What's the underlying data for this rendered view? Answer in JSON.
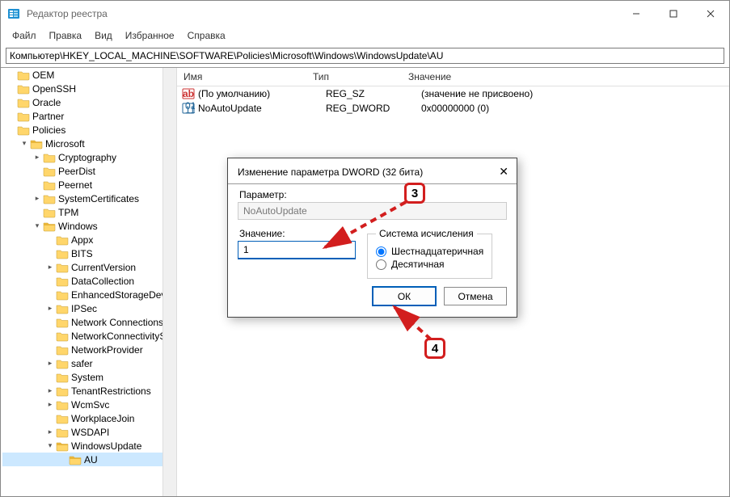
{
  "window": {
    "title": "Редактор реестра"
  },
  "menu": {
    "file": "Файл",
    "edit": "Правка",
    "view": "Вид",
    "favorites": "Избранное",
    "help": "Справка"
  },
  "address": "Компьютер\\HKEY_LOCAL_MACHINE\\SOFTWARE\\Policies\\Microsoft\\Windows\\WindowsUpdate\\AU",
  "tree": [
    {
      "label": "OEM",
      "depth": 1,
      "twisty": "",
      "open": false
    },
    {
      "label": "OpenSSH",
      "depth": 1,
      "twisty": "",
      "open": false
    },
    {
      "label": "Oracle",
      "depth": 1,
      "twisty": "",
      "open": false
    },
    {
      "label": "Partner",
      "depth": 1,
      "twisty": "",
      "open": false
    },
    {
      "label": "Policies",
      "depth": 1,
      "twisty": "",
      "open": false
    },
    {
      "label": "Microsoft",
      "depth": 2,
      "twisty": "v",
      "open": true
    },
    {
      "label": "Cryptography",
      "depth": 3,
      "twisty": ">",
      "open": false
    },
    {
      "label": "PeerDist",
      "depth": 3,
      "twisty": "",
      "open": false
    },
    {
      "label": "Peernet",
      "depth": 3,
      "twisty": "",
      "open": false
    },
    {
      "label": "SystemCertificates",
      "depth": 3,
      "twisty": ">",
      "open": false
    },
    {
      "label": "TPM",
      "depth": 3,
      "twisty": "",
      "open": false
    },
    {
      "label": "Windows",
      "depth": 3,
      "twisty": "v",
      "open": true
    },
    {
      "label": "Appx",
      "depth": 4,
      "twisty": "",
      "open": false
    },
    {
      "label": "BITS",
      "depth": 4,
      "twisty": "",
      "open": false
    },
    {
      "label": "CurrentVersion",
      "depth": 4,
      "twisty": ">",
      "open": false
    },
    {
      "label": "DataCollection",
      "depth": 4,
      "twisty": "",
      "open": false
    },
    {
      "label": "EnhancedStorageDevices",
      "depth": 4,
      "twisty": "",
      "open": false
    },
    {
      "label": "IPSec",
      "depth": 4,
      "twisty": ">",
      "open": false
    },
    {
      "label": "Network Connections",
      "depth": 4,
      "twisty": "",
      "open": false
    },
    {
      "label": "NetworkConnectivityStat",
      "depth": 4,
      "twisty": "",
      "open": false
    },
    {
      "label": "NetworkProvider",
      "depth": 4,
      "twisty": "",
      "open": false
    },
    {
      "label": "safer",
      "depth": 4,
      "twisty": ">",
      "open": false
    },
    {
      "label": "System",
      "depth": 4,
      "twisty": "",
      "open": false
    },
    {
      "label": "TenantRestrictions",
      "depth": 4,
      "twisty": ">",
      "open": false
    },
    {
      "label": "WcmSvc",
      "depth": 4,
      "twisty": ">",
      "open": false
    },
    {
      "label": "WorkplaceJoin",
      "depth": 4,
      "twisty": "",
      "open": false
    },
    {
      "label": "WSDAPI",
      "depth": 4,
      "twisty": ">",
      "open": false
    },
    {
      "label": "WindowsUpdate",
      "depth": 4,
      "twisty": "v",
      "open": true
    },
    {
      "label": "AU",
      "depth": 5,
      "twisty": "",
      "open": true,
      "selected": true
    }
  ],
  "list": {
    "columns": {
      "name": "Имя",
      "type": "Тип",
      "value": "Значение"
    },
    "rows": [
      {
        "icon": "sz",
        "name": "(По умолчанию)",
        "type": "REG_SZ",
        "value": "(значение не присвоено)"
      },
      {
        "icon": "dw",
        "name": "NoAutoUpdate",
        "type": "REG_DWORD",
        "value": "0x00000000 (0)"
      }
    ]
  },
  "dialog": {
    "title": "Изменение параметра DWORD (32 бита)",
    "param_label": "Параметр:",
    "param_value": "NoAutoUpdate",
    "value_label": "Значение:",
    "value_input": "1",
    "base_legend": "Система исчисления",
    "radio_hex": "Шестнадцатеричная",
    "radio_dec": "Десятичная",
    "ok": "ОК",
    "cancel": "Отмена"
  },
  "callouts": {
    "c3": "3",
    "c4": "4"
  }
}
